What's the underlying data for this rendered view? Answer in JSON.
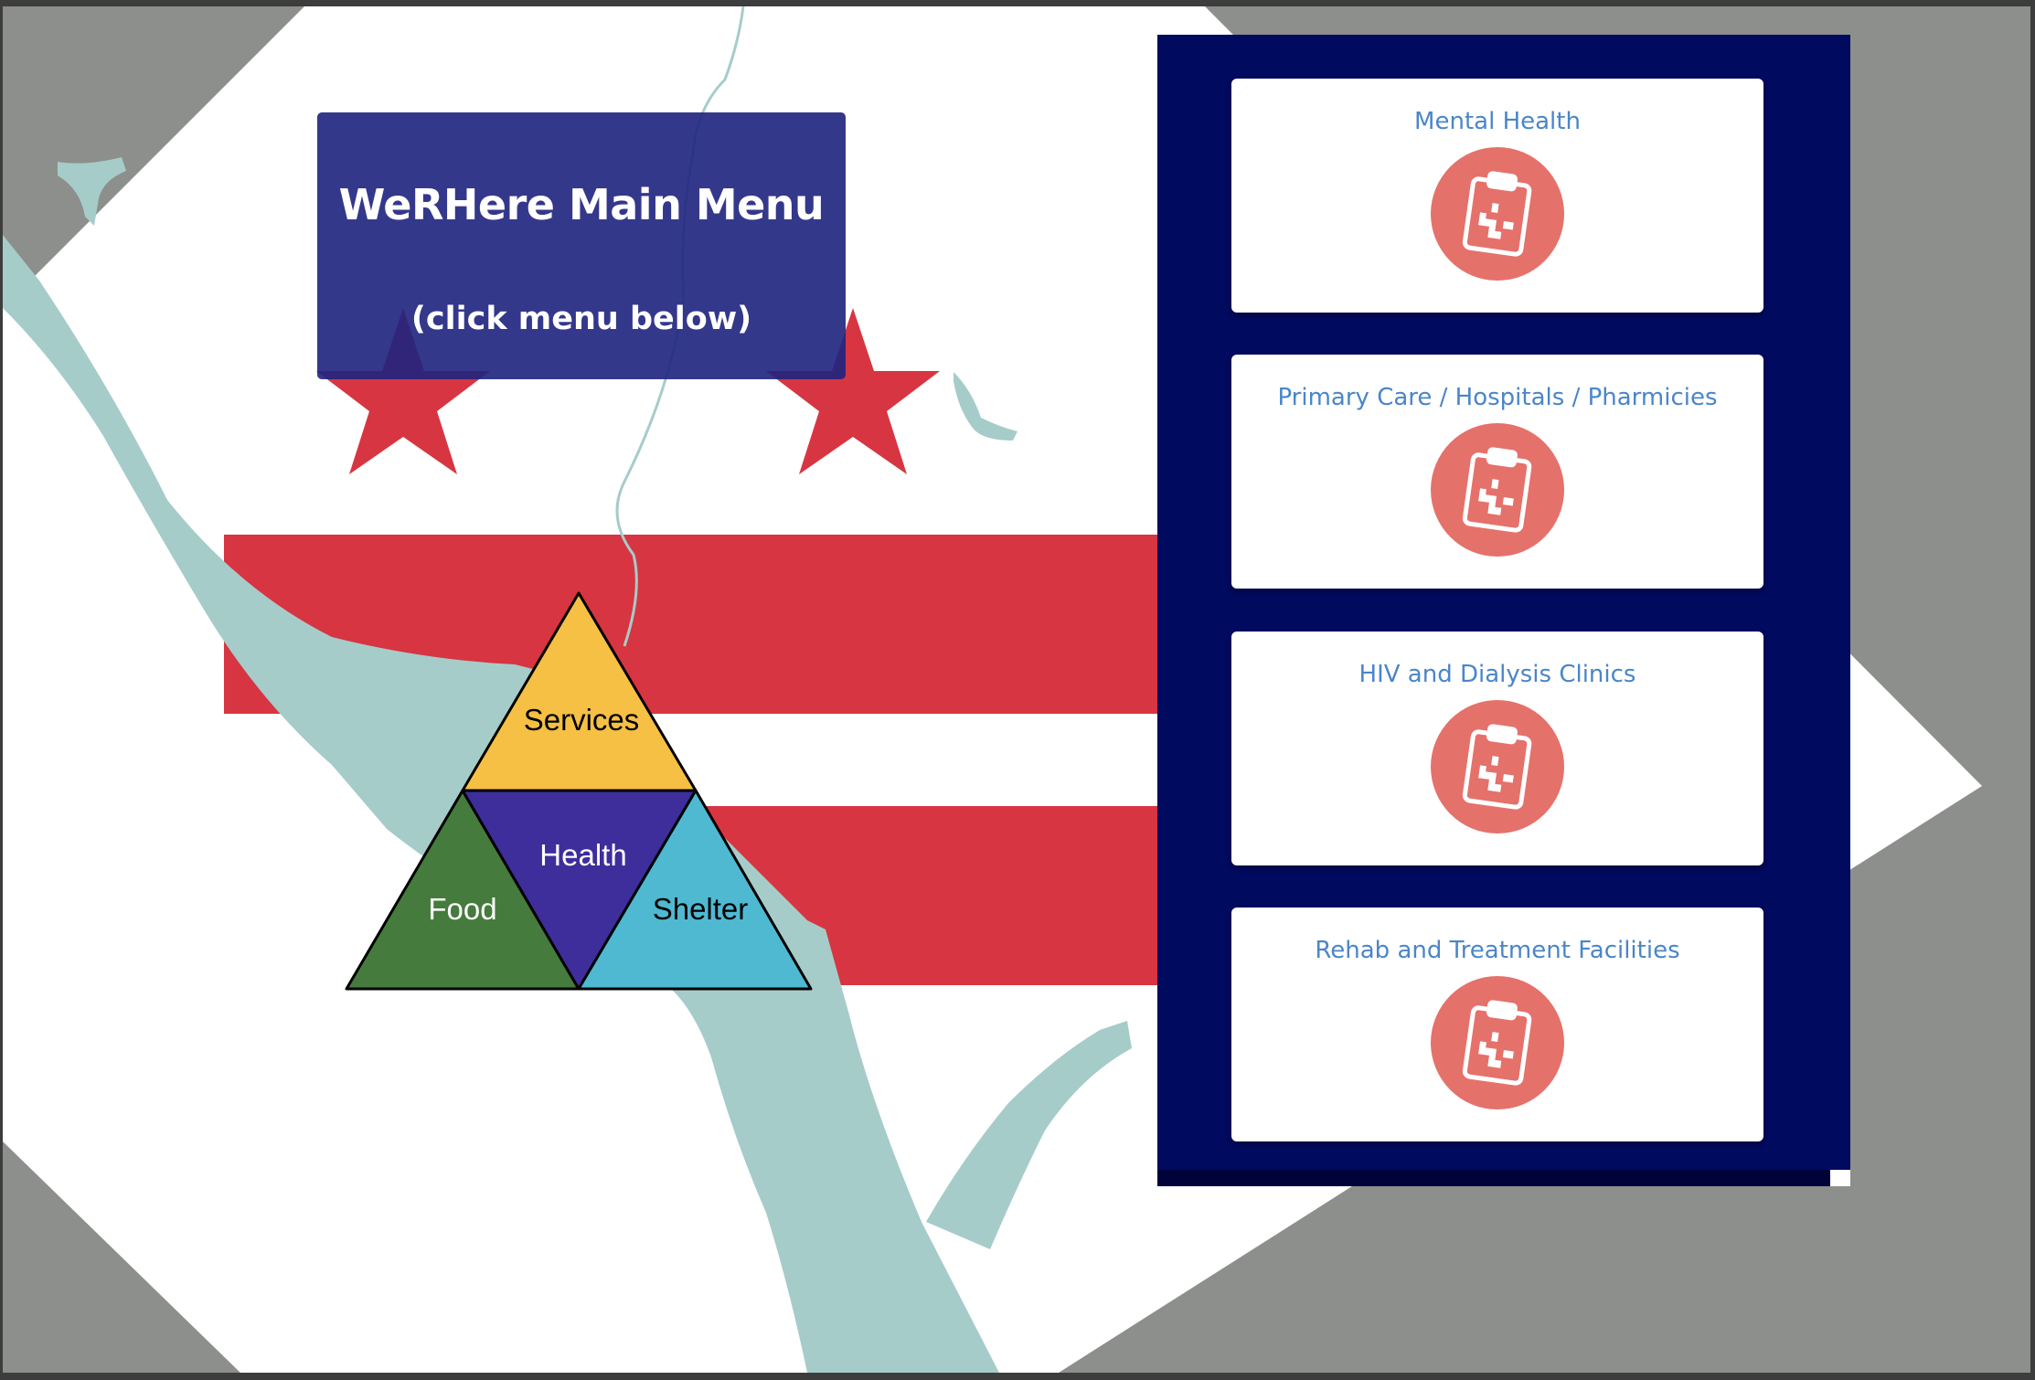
{
  "header": {
    "title": "WeRHere Main Menu",
    "subtitle": "(click menu below)"
  },
  "pyramid": {
    "services": "Services",
    "health": "Health",
    "food": "Food",
    "shelter": "Shelter"
  },
  "menu": {
    "items": [
      {
        "label": "Mental Health",
        "icon": "medical-clipboard-icon"
      },
      {
        "label": "Primary Care / Hospitals / Pharmicies",
        "icon": "medical-clipboard-icon"
      },
      {
        "label": "HIV and Dialysis Clinics",
        "icon": "medical-clipboard-icon"
      },
      {
        "label": "Rehab and Treatment Facilities",
        "icon": "medical-clipboard-icon"
      }
    ]
  },
  "colors": {
    "flag_red": "#d73541",
    "panel_navy": "#000a5e",
    "title_box": "#202480",
    "link_blue": "#4a86c8",
    "icon_circle": "#e5716b",
    "services_yellow": "#f6c045",
    "health_purple": "#3d2e9b",
    "food_green": "#457b3c",
    "shelter_blue": "#4fb9d2",
    "water": "#a6ccca",
    "land_gray": "#8d8f8c"
  }
}
